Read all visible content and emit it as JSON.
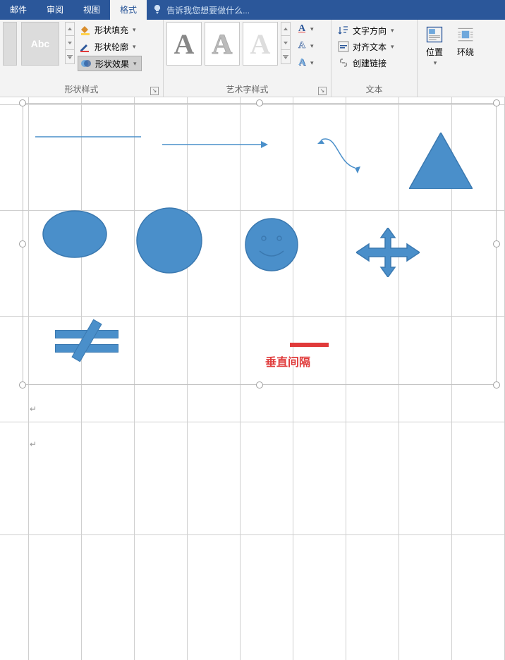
{
  "tabs": {
    "mail": "邮件",
    "review": "审阅",
    "view": "视图",
    "format": "格式",
    "tellme": "告诉我您想要做什么..."
  },
  "ribbon": {
    "shape_styles": {
      "abc": "Abc",
      "fill": "形状填充",
      "outline": "形状轮廓",
      "effects": "形状效果",
      "group_label": "形状样式"
    },
    "wordart": {
      "letter": "A",
      "group_label": "艺术字样式"
    },
    "text": {
      "direction": "文字方向",
      "align": "对齐文本",
      "link": "创建链接",
      "group_label": "文本"
    },
    "arrange": {
      "position": "位置",
      "wrap": "环绕"
    }
  },
  "canvas": {
    "annotation": "垂直间隔"
  },
  "colors": {
    "blue": "#4a8fca",
    "blue_border": "#3b79b0",
    "red": "#e03a3a"
  }
}
